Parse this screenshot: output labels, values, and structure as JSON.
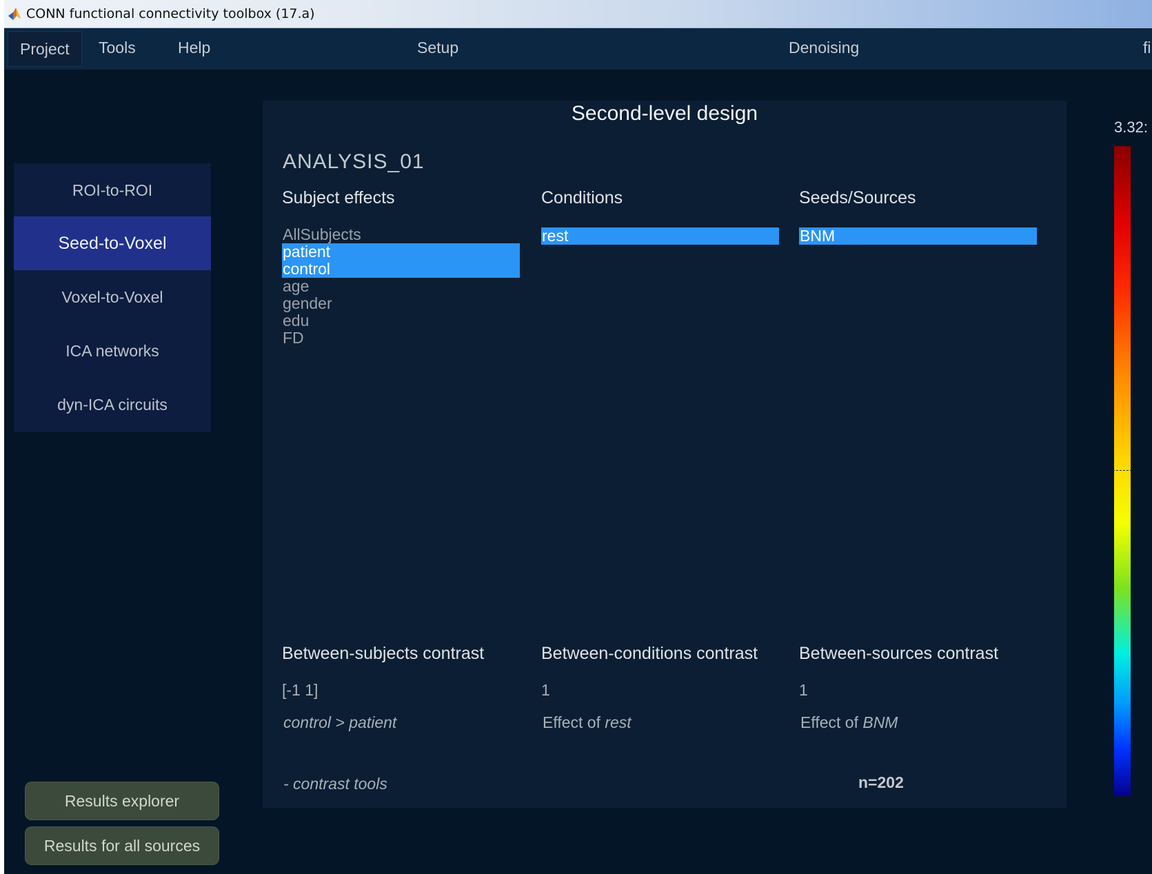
{
  "window": {
    "title": "CONN functional connectivity toolbox (17.a)"
  },
  "menu": {
    "items": [
      {
        "label": "Project"
      },
      {
        "label": "Tools"
      },
      {
        "label": "Help"
      },
      {
        "label": "Setup"
      },
      {
        "label": "Denoising"
      },
      {
        "label": "fi"
      }
    ]
  },
  "nav": {
    "items": [
      {
        "label": "ROI-to-ROI"
      },
      {
        "label": "Seed-to-Voxel",
        "active": true
      },
      {
        "label": "Voxel-to-Voxel"
      },
      {
        "label": "ICA networks"
      },
      {
        "label": "dyn-ICA circuits"
      }
    ]
  },
  "buttons": {
    "results_explorer": "Results explorer",
    "results_all_sources": "Results for all sources"
  },
  "panel": {
    "title": "Second-level design",
    "analysis_name": "ANALYSIS_01",
    "subject_effects": {
      "header": "Subject effects",
      "items": [
        {
          "label": "AllSubjects",
          "selected": false
        },
        {
          "label": "patient",
          "selected": true
        },
        {
          "label": "control",
          "selected": true
        },
        {
          "label": "age",
          "selected": false
        },
        {
          "label": "gender",
          "selected": false
        },
        {
          "label": "edu",
          "selected": false
        },
        {
          "label": "FD",
          "selected": false
        }
      ]
    },
    "conditions": {
      "header": "Conditions",
      "items": [
        {
          "label": "rest",
          "selected": true
        }
      ]
    },
    "sources": {
      "header": "Seeds/Sources",
      "items": [
        {
          "label": "BNM",
          "selected": true
        }
      ]
    },
    "between_subjects": {
      "header": "Between-subjects contrast",
      "value": "[-1 1]",
      "description": "control > patient"
    },
    "between_conditions": {
      "header": "Between-conditions contrast",
      "value": "1",
      "description_prefix": "Effect of ",
      "description_term": "rest"
    },
    "between_sources": {
      "header": "Between-sources contrast",
      "value": "1",
      "description_prefix": "Effect of ",
      "description_term": "BNM"
    },
    "contrast_tools": "- contrast tools",
    "n": "n=202"
  },
  "colorbar": {
    "max_label": "3.32:",
    "colors": [
      "#8b0000",
      "#ff2a00",
      "#ff8800",
      "#ffd400",
      "#7de21e",
      "#00f0e0",
      "#0098ff",
      "#0030ff",
      "#07008e"
    ]
  }
}
